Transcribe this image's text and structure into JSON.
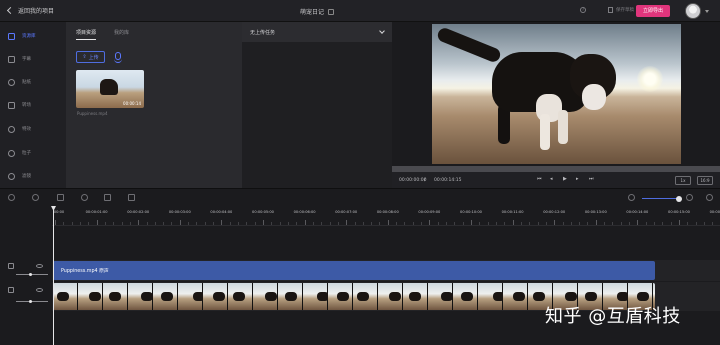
{
  "header": {
    "back_label": "返回我的项目",
    "project_title": "萌宠日记",
    "help_label": "",
    "save_label": "保存草稿",
    "export_label": "立即导出"
  },
  "sidebar": {
    "items": [
      {
        "label": "资源库",
        "icon": "library-icon",
        "active": true
      },
      {
        "label": "字幕",
        "icon": "text-icon",
        "active": false
      },
      {
        "label": "贴纸",
        "icon": "sticker-icon",
        "active": false
      },
      {
        "label": "转场",
        "icon": "transition-icon",
        "active": false
      },
      {
        "label": "特效",
        "icon": "effect-icon",
        "active": false
      },
      {
        "label": "粒子",
        "icon": "particle-icon",
        "active": false
      },
      {
        "label": "滤镜",
        "icon": "filter-icon",
        "active": false
      }
    ]
  },
  "resources": {
    "tabs": [
      {
        "label": "项目资源",
        "active": true
      },
      {
        "label": "我的库",
        "active": false
      }
    ],
    "upload_label": "上传",
    "media": [
      {
        "name": "Puppiness.mp4",
        "duration": "00:00:14"
      }
    ]
  },
  "task_panel": {
    "title": "无上传任务"
  },
  "player": {
    "current_time": "00:00:00:00",
    "total_time": "00:00:14:15",
    "ratio_buttons": [
      "1x",
      "16:9"
    ],
    "progress": 0
  },
  "timeline": {
    "ticks": [
      "00:00",
      "00:00:01:00",
      "00:00:02:00",
      "00:00:03:00",
      "00:00:04:00",
      "00:00:05:00",
      "00:00:06:00",
      "00:00:07:00",
      "00:00:08:00",
      "00:00:09:00",
      "00:00:10:00",
      "00:00:11:00",
      "00:00:12:00",
      "00:00:13:00",
      "00:00:14:00",
      "00:00:15:00",
      "00:00:16:00"
    ],
    "audio_clip_label": "Puppiness.mp4 原声",
    "zoom_level": 0.9
  },
  "watermark": "知乎 @互盾科技",
  "colors": {
    "accent": "#5b78ff",
    "export": "#e0357c",
    "audio_clip": "#3d5aa6"
  }
}
